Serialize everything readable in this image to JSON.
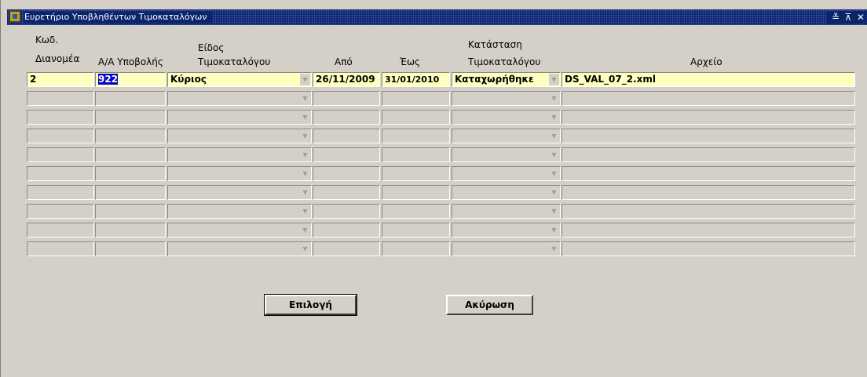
{
  "window": {
    "title": "Ευρετήριο Υποβληθέντων Τιμοκαταλόγων",
    "title_icon": "app-icon",
    "controls": [
      "≚",
      "⊼",
      "✕"
    ]
  },
  "columns": {
    "distributor_code_1": "Κωδ.",
    "distributor_code_2": "Διανομέα",
    "submission_no": "Α/Α Υποβολής",
    "pricelist_type_1": "Είδος",
    "pricelist_type_2": "Τιμοκαταλόγου",
    "from": "Από",
    "to": "Έως",
    "status_1": "Κατάσταση",
    "status_2": "Τιμοκαταλόγου",
    "file": "Αρχείο"
  },
  "rows": [
    {
      "code": "2",
      "submission": "922",
      "type": "Κύριος",
      "from": "26/11/2009",
      "to": "31/01/2010",
      "status": "Καταχωρήθηκε",
      "file": "DS_VAL_07_2.xml"
    }
  ],
  "empty_rows": 9,
  "buttons": {
    "select": "Επιλογή",
    "cancel": "Ακύρωση"
  },
  "colors": {
    "titlebar": "#0b246a",
    "active_row": "#ffffc0",
    "selection": "#0000c8",
    "background": "#d4d0c8"
  }
}
